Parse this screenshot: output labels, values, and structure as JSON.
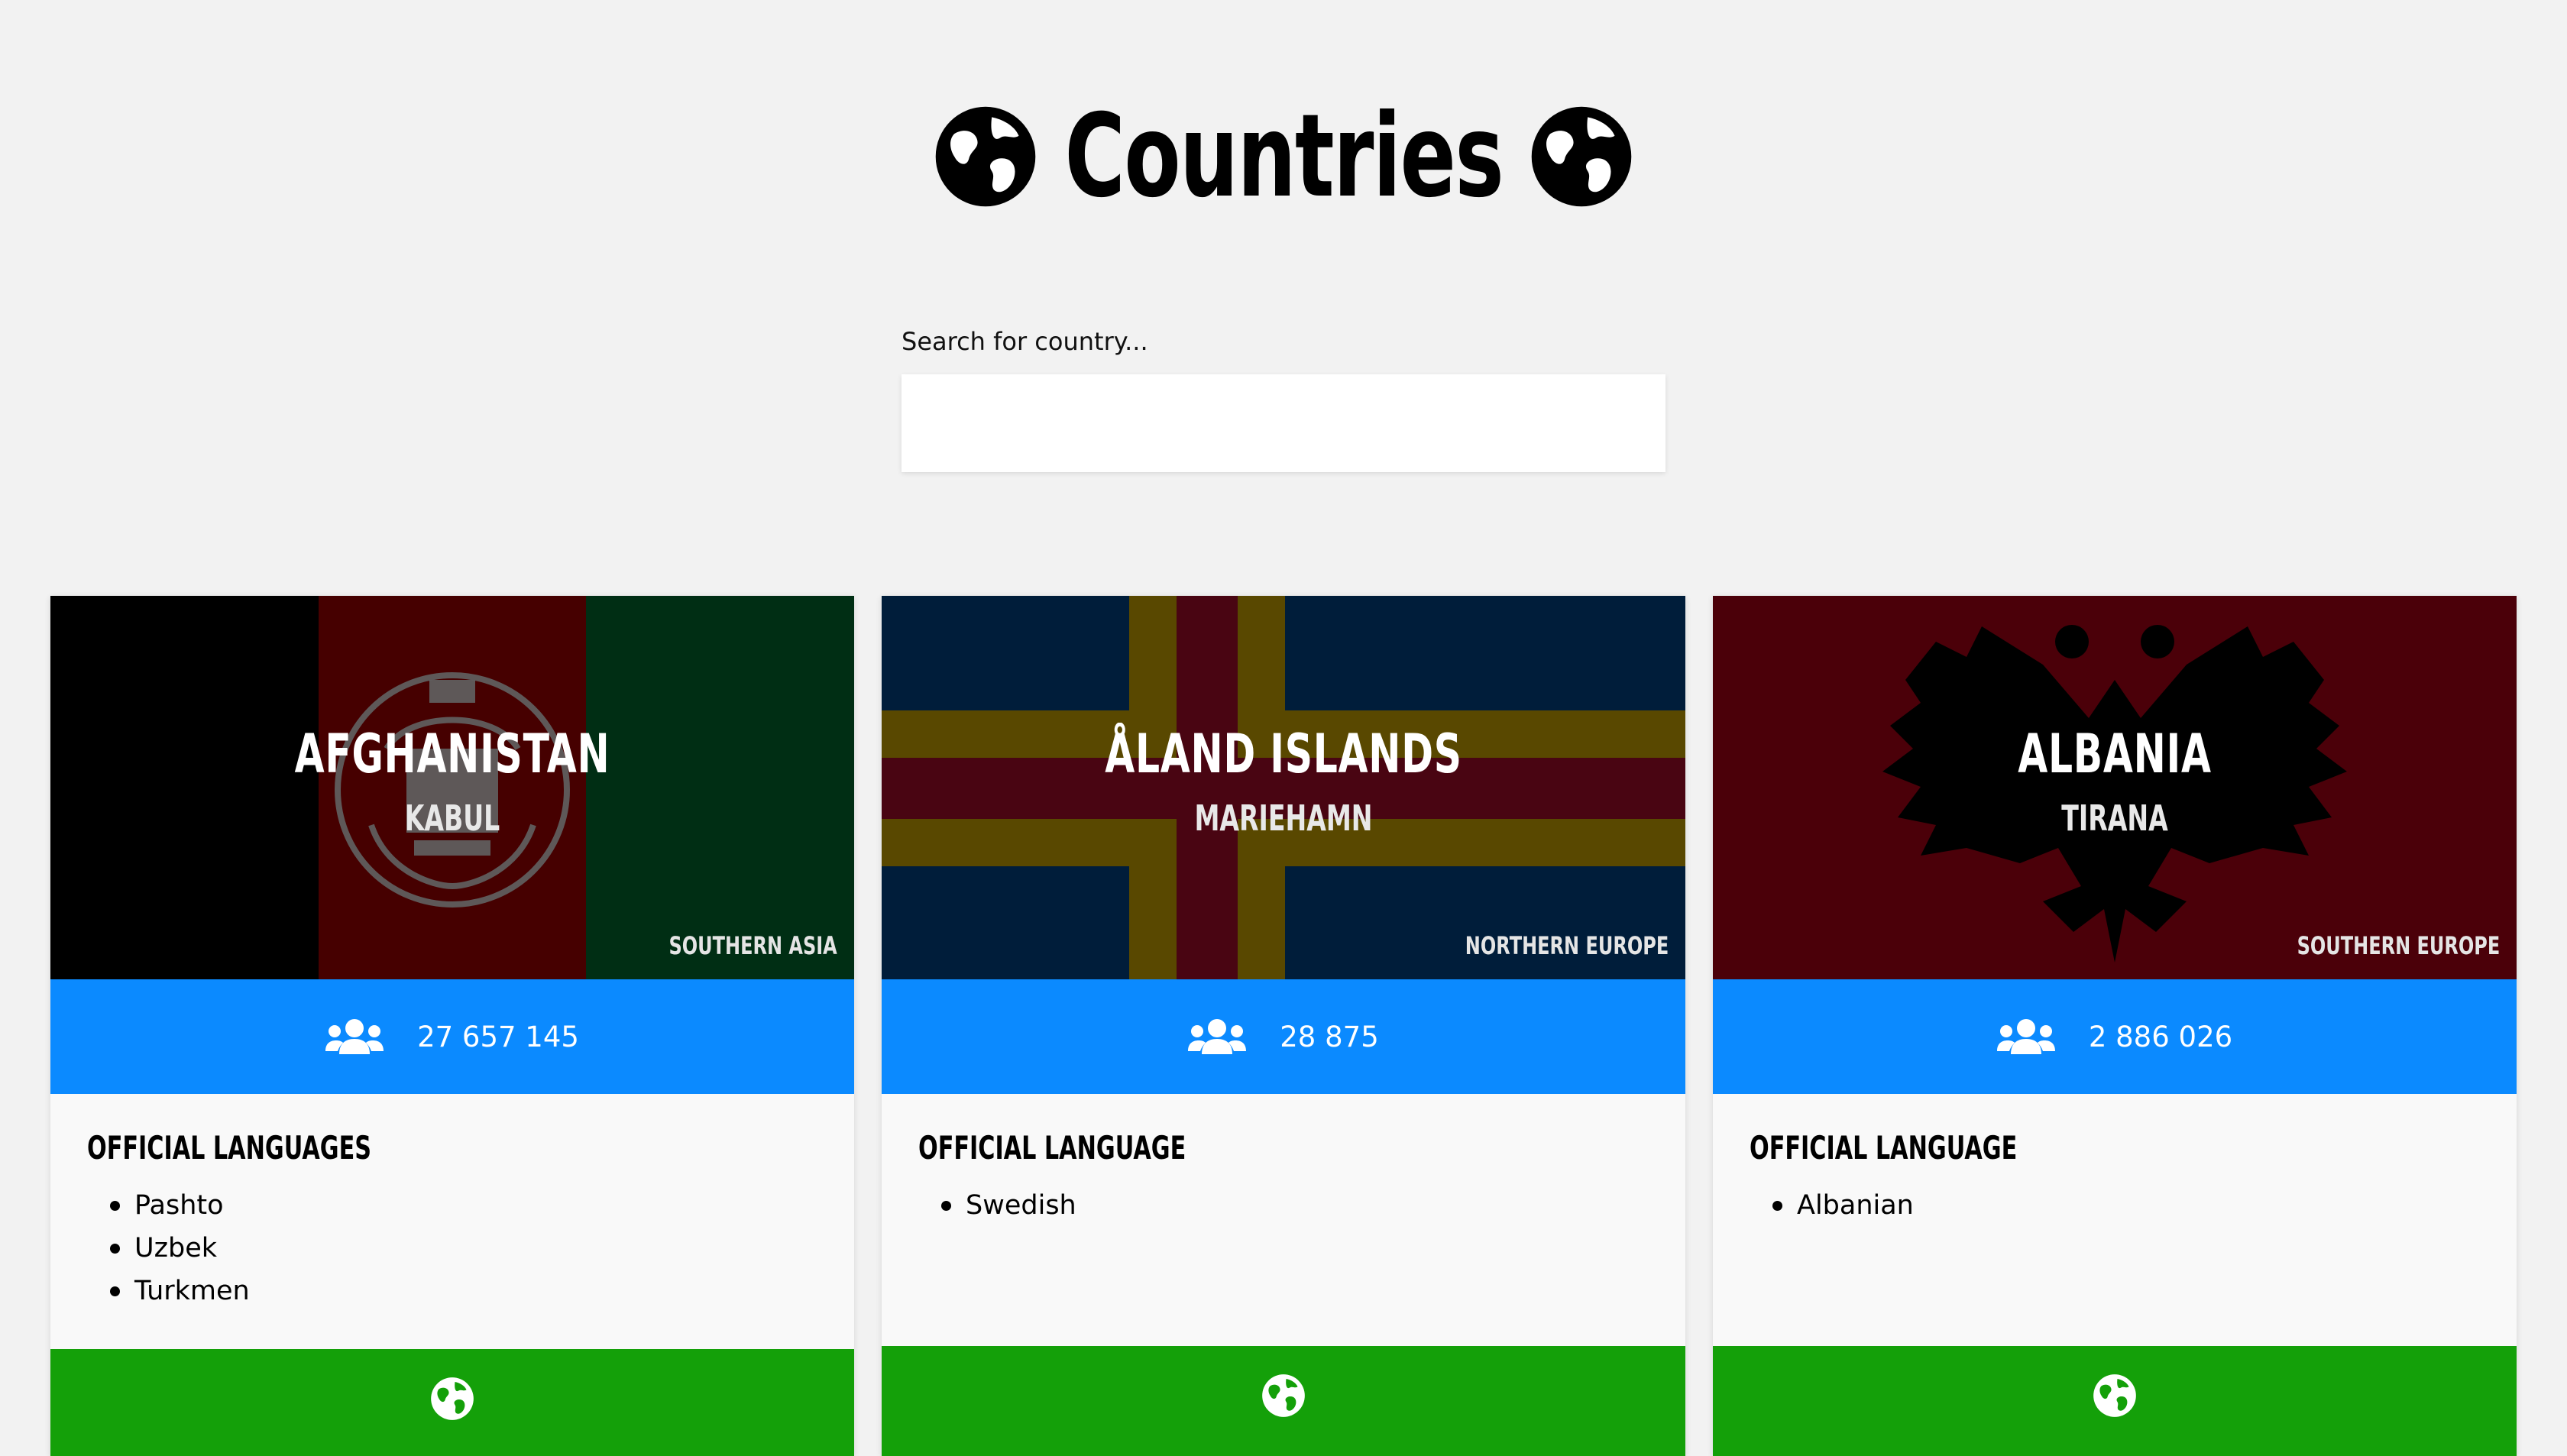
{
  "header": {
    "title": "Countries",
    "left_icon": "globe-icon",
    "right_icon": "globe-icon"
  },
  "search": {
    "label": "Search for country...",
    "value": "",
    "placeholder": ""
  },
  "colors": {
    "background": "#f2f2f2",
    "population_bar": "#0b8aff",
    "map_bar": "#14a009"
  },
  "countries": [
    {
      "name": "AFGHANISTAN",
      "capital": "KABUL",
      "region": "SOUTHERN ASIA",
      "population": "27 657 145",
      "languages_heading": "OFFICIAL LANGUAGES",
      "languages": [
        "Pashto",
        "Uzbek",
        "Turkmen"
      ],
      "flag": "afghanistan-flag",
      "population_icon": "users-icon",
      "map_icon": "globe-icon"
    },
    {
      "name": "ÅLAND ISLANDS",
      "capital": "MARIEHAMN",
      "region": "NORTHERN EUROPE",
      "population": "28 875",
      "languages_heading": "OFFICIAL LANGUAGE",
      "languages": [
        "Swedish"
      ],
      "flag": "aland-flag",
      "population_icon": "users-icon",
      "map_icon": "globe-icon"
    },
    {
      "name": "ALBANIA",
      "capital": "TIRANA",
      "region": "SOUTHERN EUROPE",
      "population": "2 886 026",
      "languages_heading": "OFFICIAL LANGUAGE",
      "languages": [
        "Albanian"
      ],
      "flag": "albania-flag",
      "population_icon": "users-icon",
      "map_icon": "globe-icon"
    }
  ]
}
